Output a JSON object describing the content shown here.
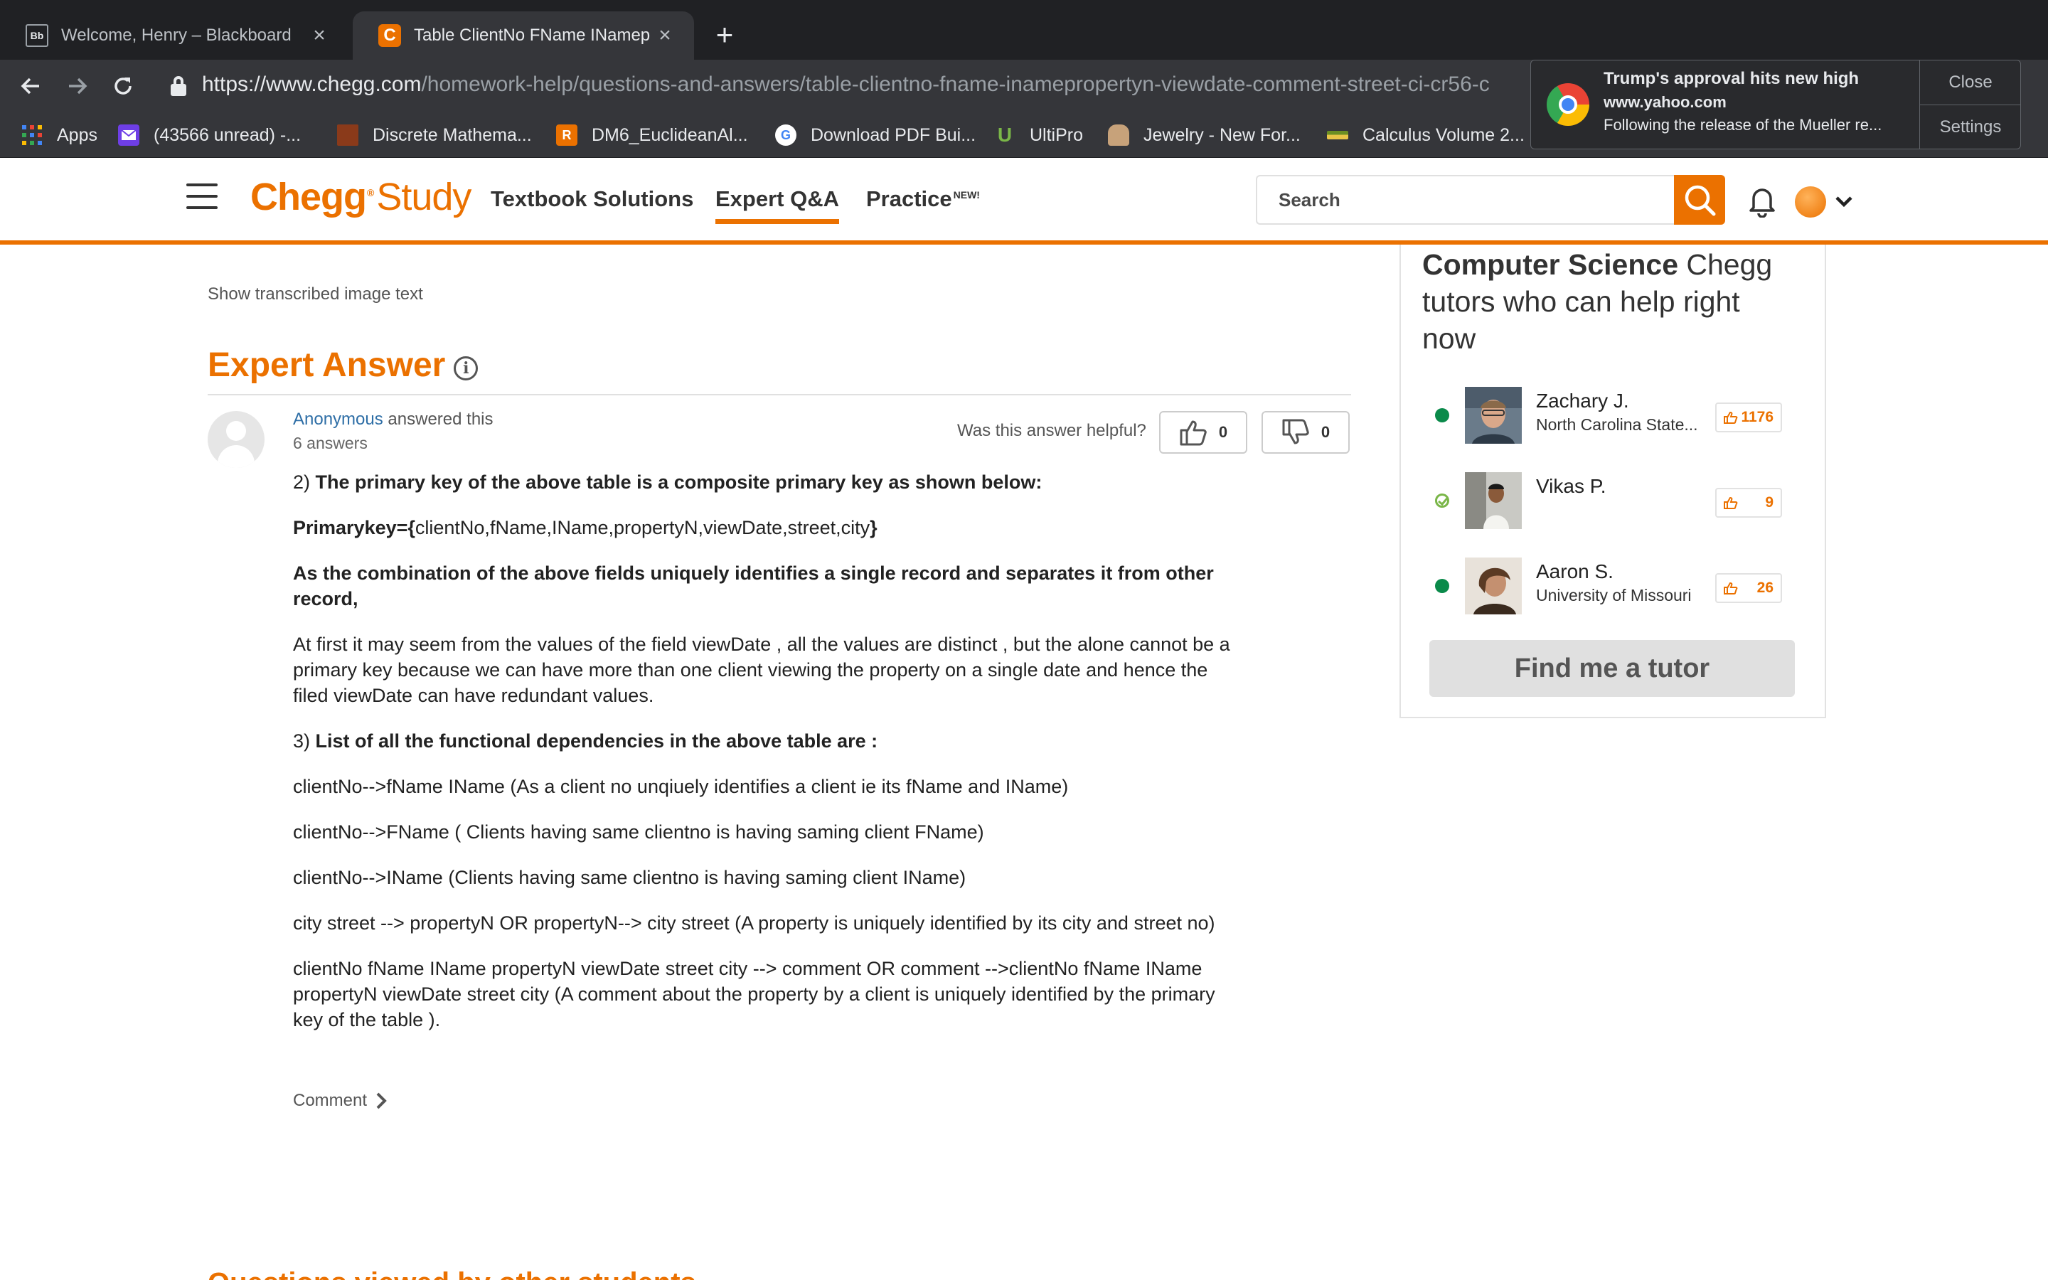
{
  "browser": {
    "tabs": [
      {
        "title": "Welcome, Henry – Blackboard",
        "icon": "blackboard-icon",
        "icon_text": "Bb",
        "active": false
      },
      {
        "title": "Table ClientNo FName INamep",
        "icon": "chegg-icon",
        "icon_text": "C",
        "active": true
      }
    ],
    "url_host": "https://www.chegg.com",
    "url_path": "/homework-help/questions-and-answers/table-clientno-fname-inamepropertyn-viewdate-comment-street-ci-cr56-c",
    "bookmarks": [
      {
        "label": "Apps",
        "icon": "apps-grid-icon"
      },
      {
        "label": "(43566 unread) -...",
        "icon": "yahoo-mail-icon"
      },
      {
        "label": "Discrete Mathema...",
        "icon": "book-icon"
      },
      {
        "label": "DM6_EuclideanAl...",
        "icon": "r-icon",
        "icon_text": "R"
      },
      {
        "label": "Download PDF Bui...",
        "icon": "google-icon",
        "icon_text": "G"
      },
      {
        "label": "UltiPro",
        "icon": "ultipro-icon",
        "icon_text": "U"
      },
      {
        "label": "Jewelry - New For...",
        "icon": "jewelry-icon"
      },
      {
        "label": "Calculus Volume 2...",
        "icon": "calculus-icon"
      }
    ]
  },
  "notification": {
    "title": "Trump's approval hits new high",
    "site": "www.yahoo.com",
    "body": "Following the release of the Mueller re...",
    "close_label": "Close",
    "settings_label": "Settings"
  },
  "header": {
    "logo_main": "Chegg",
    "logo_reg": "®",
    "logo_sub": "Study",
    "nav": [
      {
        "label": "Textbook Solutions",
        "active": false
      },
      {
        "label": "Expert Q&A",
        "active": true
      },
      {
        "label": "Practice",
        "badge": "NEW!",
        "active": false
      }
    ],
    "search_placeholder": "Search",
    "accent": "#eb7100"
  },
  "content": {
    "show_transcribed": "Show transcribed image text",
    "expert_answer_title": "Expert Answer",
    "answerer_name": "Anonymous",
    "answered_text": " answered this",
    "answers_count": "6 answers",
    "helpful_question": "Was this answer helpful?",
    "thumbs_up_count": "0",
    "thumbs_down_count": "0",
    "answer": {
      "p1_num": "2) ",
      "p1_bold": "The primary key of the above table is a composite primary key as shown below:",
      "p2_bold_start": "Primarykey={",
      "p2_text": "clientNo,fName,IName,propertyN,viewDate,street,city",
      "p2_bold_end": "}",
      "p3_bold": "As the combination of the above fields uniquely identifies a single record and separates it from other record,",
      "p4": "At first it may seem from the values of the field viewDate , all the values are distinct , but the alone cannot be a primary key because we can have more than one client viewing the property on a single date and hence the filed viewDate can have redundant values.",
      "p5_num": "3) ",
      "p5_bold": "List of all the functional dependencies in the above table are :",
      "fd1": "clientNo-->fName IName (As a client no unqiuely identifies a client ie its fName and IName)",
      "fd2": "clientNo-->FName ( Clients having same clientno is having saming client FName)",
      "fd3": "clientNo-->IName (Clients having same clientno is having saming client IName)",
      "fd4": "city street --> propertyN OR propertyN--> city street (A property is uniquely identified by its city and street no)",
      "fd5": "clientNo fName IName propertyN viewDate street city --> comment OR comment -->clientNo fName IName propertyN viewDate street city (A comment about the property by a client is uniquely identified by the primary key of the table )."
    },
    "comment_label": "Comment",
    "bottom_heading": "Questions viewed by other students"
  },
  "sidebar": {
    "heading_bold": "Computer Science",
    "heading_rest": " Chegg tutors who can help right now",
    "tutors": [
      {
        "name": "Zachary J.",
        "school": "North Carolina State...",
        "likes": "1176",
        "status": "online"
      },
      {
        "name": "Vikas P.",
        "school": "",
        "likes": "9",
        "status": "verified"
      },
      {
        "name": "Aaron S.",
        "school": "University of Missouri",
        "likes": "26",
        "status": "online"
      }
    ],
    "find_tutor_label": "Find me a tutor"
  }
}
